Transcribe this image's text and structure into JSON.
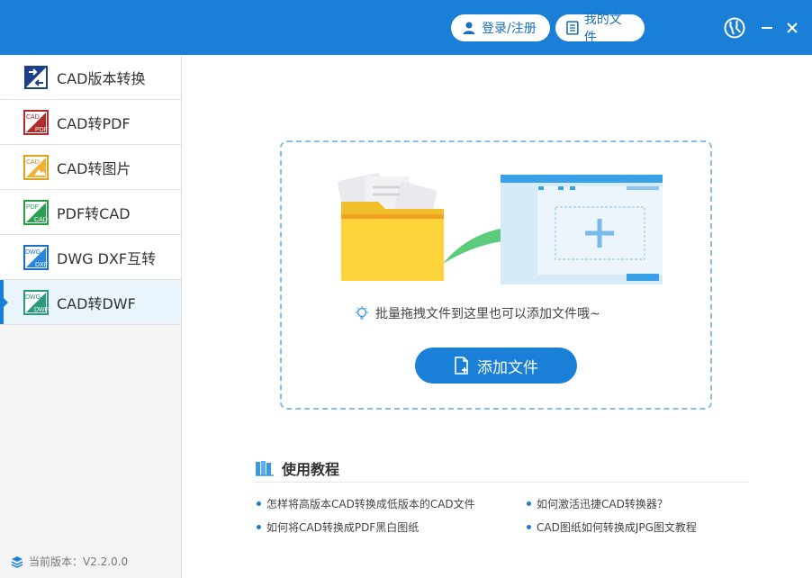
{
  "titlebar": {
    "login_label": "登录/注册",
    "files_label": "我的文件",
    "accent": "#1a7fd6"
  },
  "sidebar": {
    "items": [
      {
        "label": "CAD版本转换",
        "icon": "version-convert-icon"
      },
      {
        "label": "CAD转PDF",
        "icon": "cad-to-pdf-icon"
      },
      {
        "label": "CAD转图片",
        "icon": "cad-to-image-icon"
      },
      {
        "label": "PDF转CAD",
        "icon": "pdf-to-cad-icon"
      },
      {
        "label": "DWG DXF互转",
        "icon": "dwg-dxf-icon"
      },
      {
        "label": "CAD转DWF",
        "icon": "cad-to-dwf-icon"
      }
    ],
    "active_index": 5,
    "version": "当前版本：V2.2.0.0"
  },
  "dropzone": {
    "hint": "批量拖拽文件到这里也可以添加文件哦~",
    "add_button": "添加文件"
  },
  "tutorial": {
    "title": "使用教程",
    "links": [
      "怎样将高版本CAD转换成低版本的CAD文件",
      "如何激活迅捷CAD转换器？",
      "如何将CAD转换成PDF黑白图纸",
      "CAD图纸如何转换成JPG图文教程"
    ]
  }
}
